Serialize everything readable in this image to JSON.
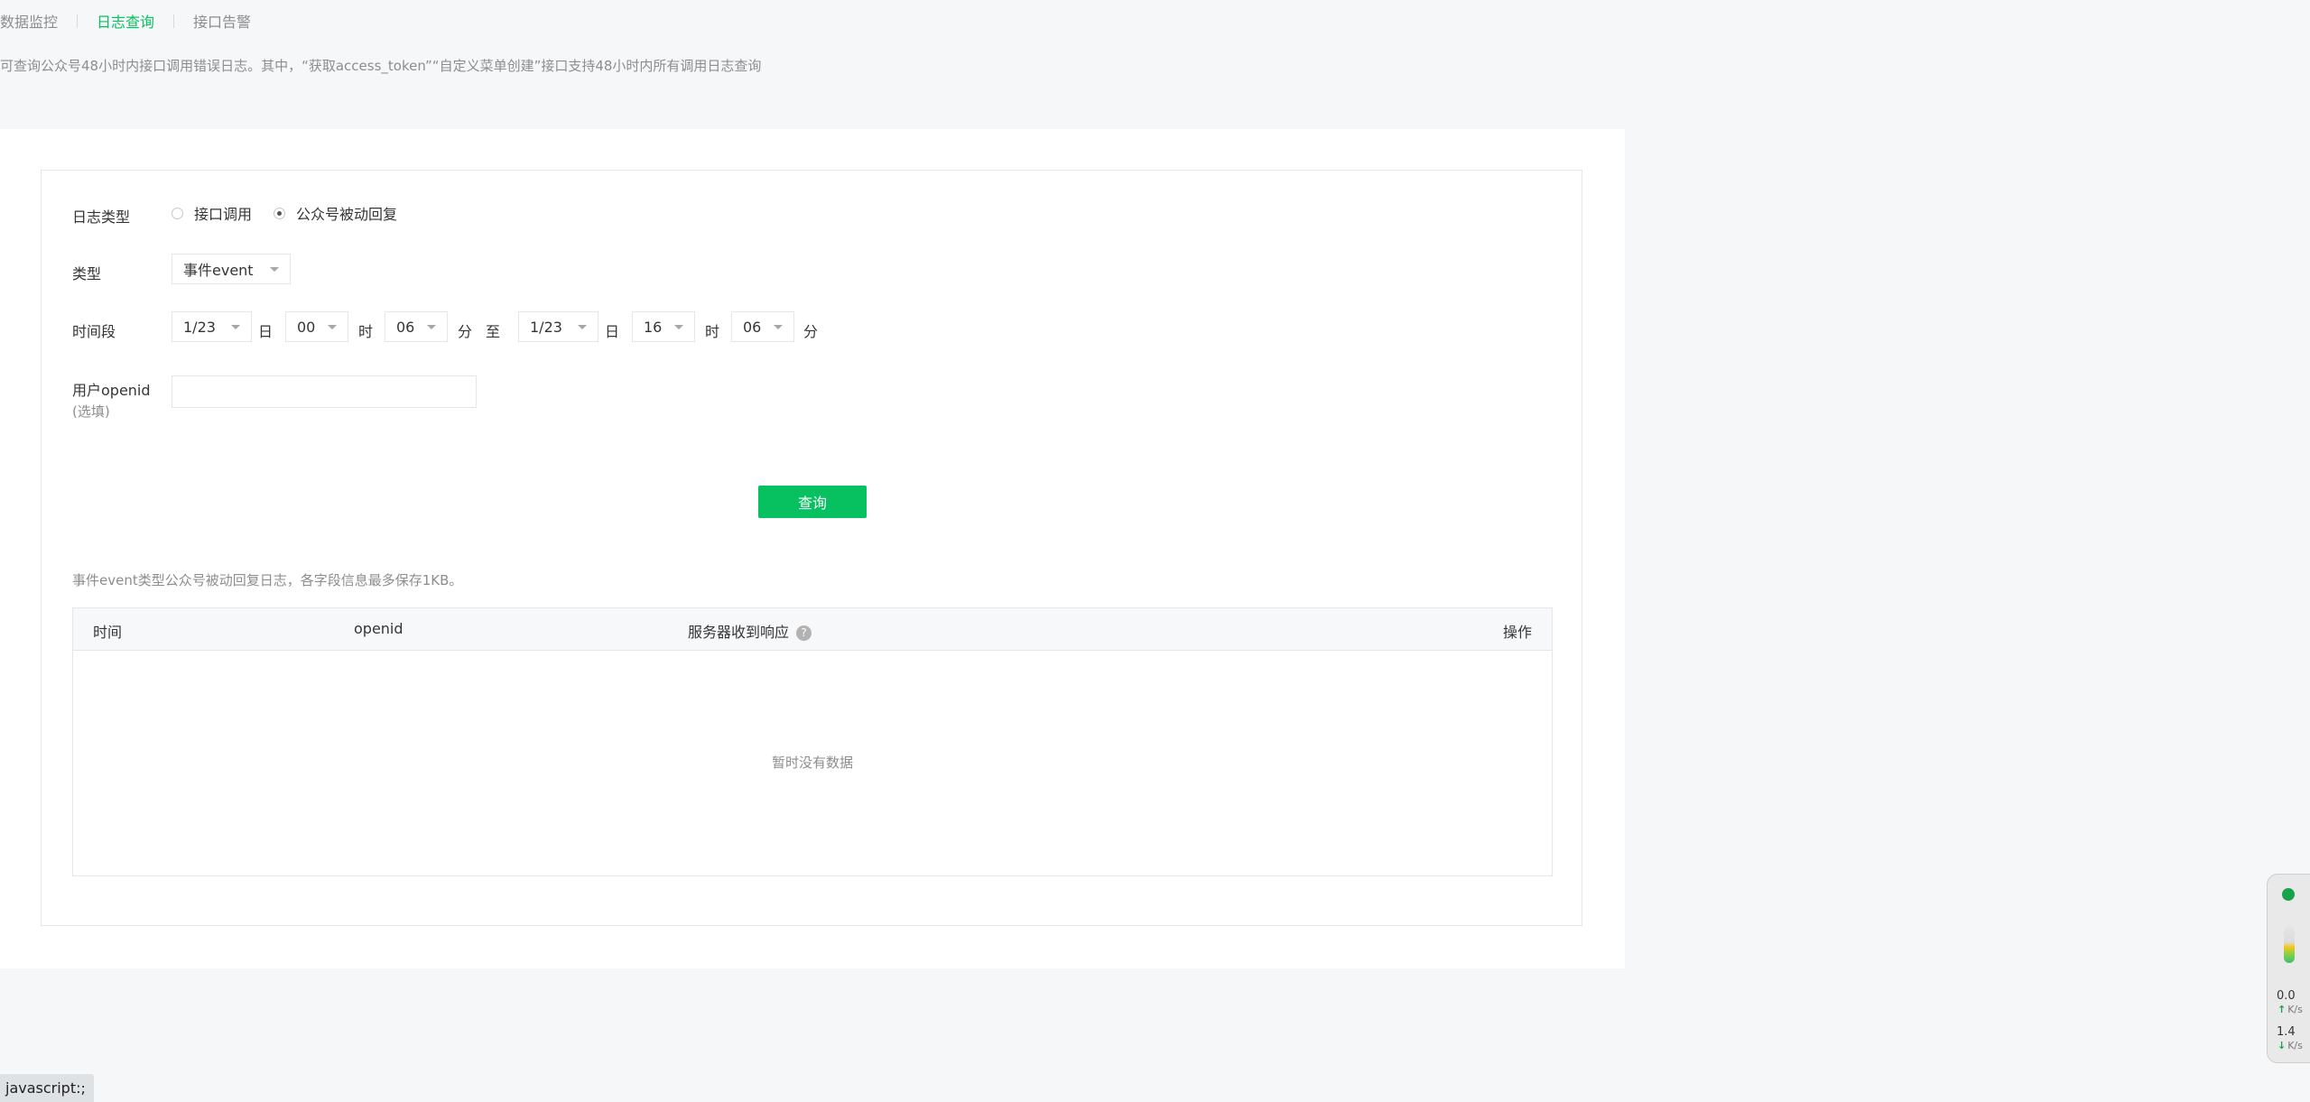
{
  "tabs": [
    {
      "label": "数据监控",
      "active": false
    },
    {
      "label": "日志查询",
      "active": true
    },
    {
      "label": "接口告警",
      "active": false
    }
  ],
  "notice": "可查询公众号48小时内接口调用错误日志。其中，“获取access_token”“自定义菜单创建”接口支持48小时内所有调用日志查询",
  "form": {
    "log_type": {
      "label": "日志类型",
      "options": [
        "接口调用",
        "公众号被动回复"
      ],
      "selected": "公众号被动回复"
    },
    "type": {
      "label": "类型",
      "value": "事件event"
    },
    "time_range": {
      "label": "时间段",
      "start_date": "1/23",
      "start_hour": "00",
      "start_minute": "06",
      "end_date": "1/23",
      "end_hour": "16",
      "end_minute": "06",
      "unit_day": "日",
      "unit_hour": "时",
      "unit_minute": "分",
      "to": "至"
    },
    "openid": {
      "label": "用户openid",
      "sublabel": "(选填)",
      "value": "",
      "placeholder": ""
    },
    "query_label": "查询"
  },
  "table": {
    "note": "事件event类型公众号被动回复日志，各字段信息最多保存1KB。",
    "columns": [
      "时间",
      "openid",
      "服务器收到响应",
      "操作"
    ],
    "help_icon": "?",
    "rows": [],
    "empty_text": "暂时没有数据"
  },
  "status_bar": "javascript:;",
  "speed_widget": {
    "upload": "0.0",
    "download": "1.4",
    "unit": "K/s",
    "arrow_up": "↑",
    "arrow_down": "↓",
    "status_color": "#16a34a"
  },
  "colors": {
    "accent": "#07c160",
    "background": "#f6f7f9"
  }
}
